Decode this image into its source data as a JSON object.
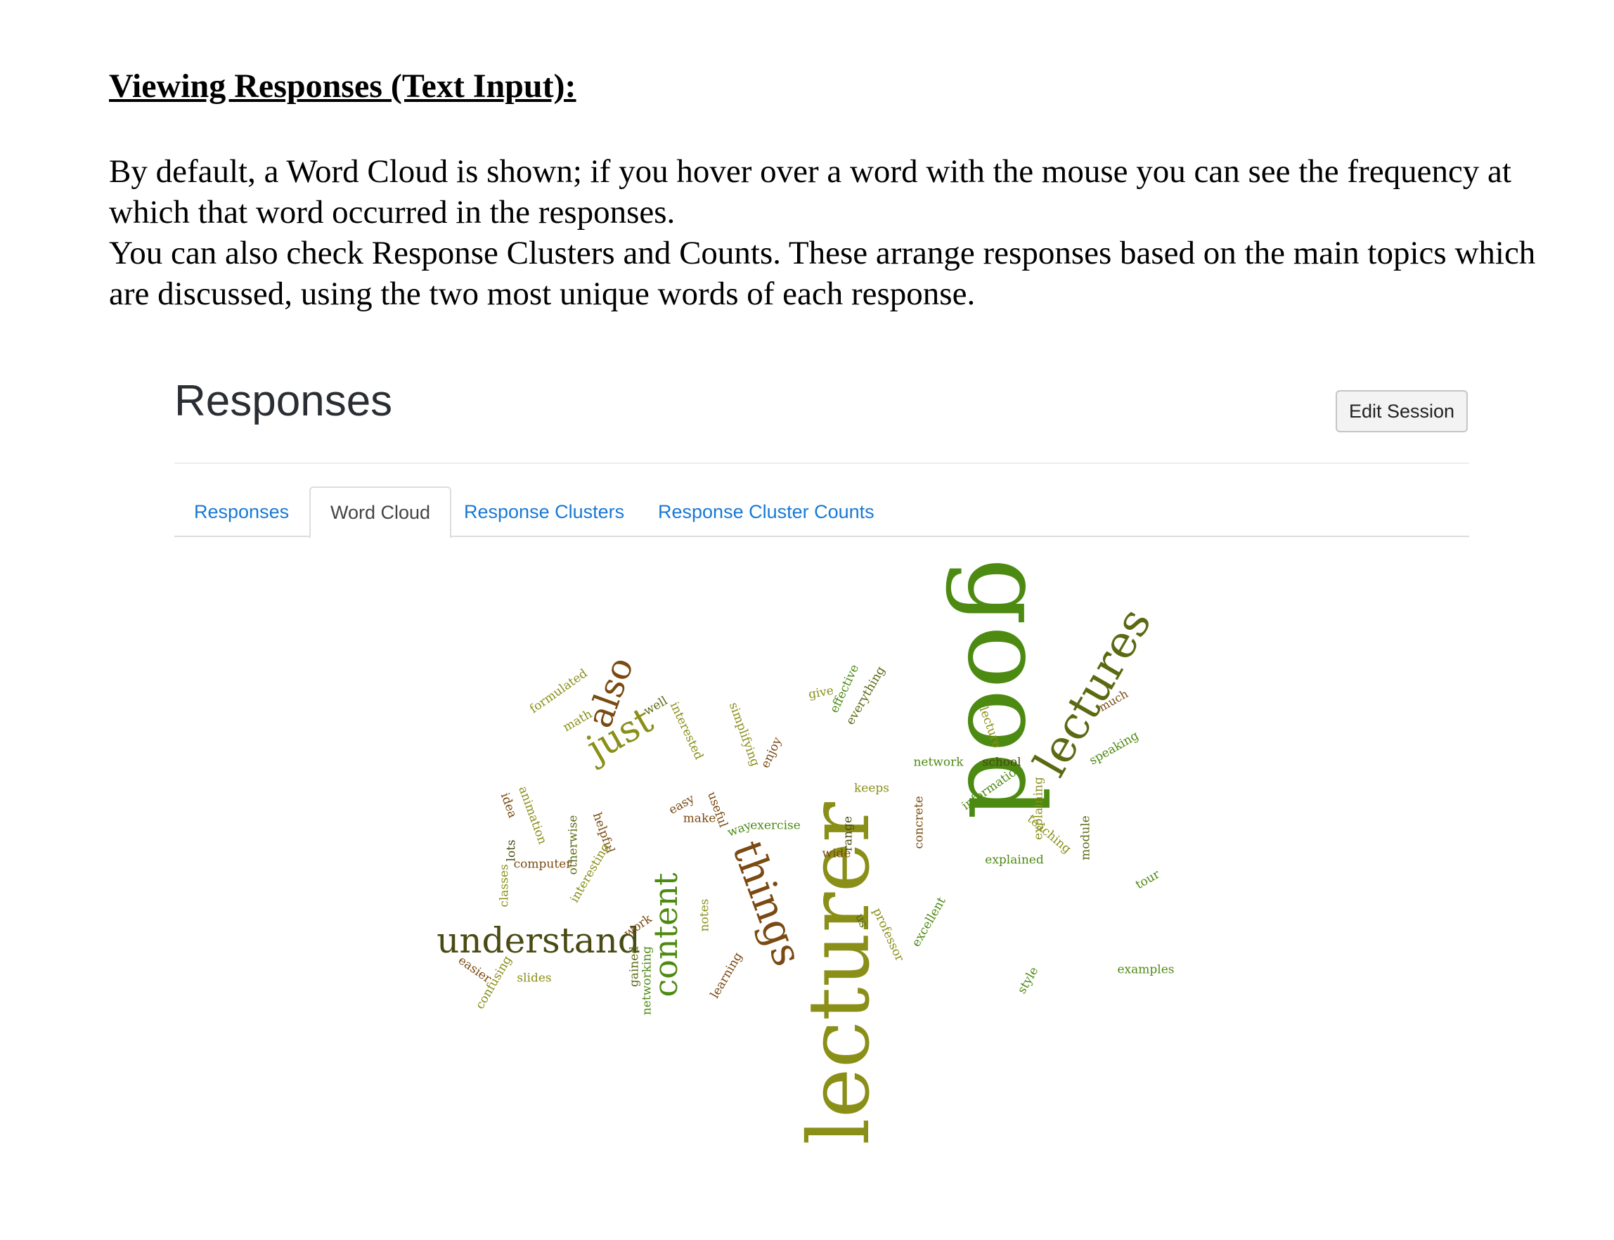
{
  "document": {
    "title": "Viewing Responses (Text Input):",
    "paragraph1": "By default, a Word Cloud is shown; if you hover over a word with the mouse you can see the frequency at which that word occurred in the responses.",
    "paragraph2": "You can also check Response Clusters and Counts. These arrange responses based on the main topics which are discussed, using the two most unique words of each response."
  },
  "ui": {
    "heading": "Responses",
    "edit_button": "Edit Session",
    "tabs": [
      {
        "label": "Responses",
        "active": false
      },
      {
        "label": "Word Cloud",
        "active": true
      },
      {
        "label": "Response Clusters",
        "active": false
      },
      {
        "label": "Response Cluster Counts",
        "active": false
      }
    ],
    "colors": {
      "green": "#4d8a12",
      "olive": "#8a8f18",
      "brown": "#7a4a12",
      "dark": "#4a4a14",
      "link": "#1779d6"
    }
  },
  "word_cloud": [
    {
      "text": "good",
      "color": "#4d8a12"
    },
    {
      "text": "lecturer",
      "color": "#8a8f18"
    },
    {
      "text": "lectures",
      "color": "#5b6a12"
    },
    {
      "text": "things",
      "color": "#7a4a12"
    },
    {
      "text": "understand",
      "color": "#4a4a14"
    },
    {
      "text": "content",
      "color": "#4d8a12"
    },
    {
      "text": "just",
      "color": "#8a8f18"
    },
    {
      "text": "also",
      "color": "#7a4a12"
    },
    {
      "text": "formulated",
      "color": "#8a8f18"
    },
    {
      "text": "math",
      "color": "#8a8f18"
    },
    {
      "text": "well",
      "color": "#5b6a12"
    },
    {
      "text": "interested",
      "color": "#8a8f18"
    },
    {
      "text": "simplifying",
      "color": "#8a8f18"
    },
    {
      "text": "enjoy",
      "color": "#7a4a12"
    },
    {
      "text": "give",
      "color": "#8a8f18"
    },
    {
      "text": "effective",
      "color": "#4d8a12"
    },
    {
      "text": "everything",
      "color": "#5b6a12"
    },
    {
      "text": "much",
      "color": "#7a4a12"
    },
    {
      "text": "speaking",
      "color": "#4d8a12"
    },
    {
      "text": "lecture",
      "color": "#8a8f18"
    },
    {
      "text": "network",
      "color": "#4d8a12"
    },
    {
      "text": "school",
      "color": "#4a4a14"
    },
    {
      "text": "information",
      "color": "#4d8a12"
    },
    {
      "text": "keeps",
      "color": "#8a8f18"
    },
    {
      "text": "explaining",
      "color": "#8a8f18"
    },
    {
      "text": "teaching",
      "color": "#8a8f18"
    },
    {
      "text": "module",
      "color": "#5b6a12"
    },
    {
      "text": "explained",
      "color": "#4d8a12"
    },
    {
      "text": "tour",
      "color": "#4d8a12"
    },
    {
      "text": "examples",
      "color": "#4d8a12"
    },
    {
      "text": "style",
      "color": "#4d8a12"
    },
    {
      "text": "excellent",
      "color": "#4d8a12"
    },
    {
      "text": "professor",
      "color": "#8a8f18"
    },
    {
      "text": "us",
      "color": "#5b6a12"
    },
    {
      "text": "concrete",
      "color": "#7a4a12"
    },
    {
      "text": "range",
      "color": "#4a4a14"
    },
    {
      "text": "wide",
      "color": "#7a4a12"
    },
    {
      "text": "exercise",
      "color": "#4d8a12"
    },
    {
      "text": "way",
      "color": "#4d8a12"
    },
    {
      "text": "make",
      "color": "#7a4a12"
    },
    {
      "text": "easy",
      "color": "#7a4a12"
    },
    {
      "text": "useful",
      "color": "#7a4a12"
    },
    {
      "text": "idea",
      "color": "#7a4a12"
    },
    {
      "text": "animation",
      "color": "#8a8f18"
    },
    {
      "text": "lots",
      "color": "#4a4a14"
    },
    {
      "text": "otherwise",
      "color": "#5b6a12"
    },
    {
      "text": "helpful",
      "color": "#7a4a12"
    },
    {
      "text": "computer",
      "color": "#7a4a12"
    },
    {
      "text": "interesting",
      "color": "#8a8f18"
    },
    {
      "text": "classes",
      "color": "#8a8f18"
    },
    {
      "text": "work",
      "color": "#7a4a12"
    },
    {
      "text": "notes",
      "color": "#8a8f18"
    },
    {
      "text": "gained",
      "color": "#5b6a12"
    },
    {
      "text": "networking",
      "color": "#4d8a12"
    },
    {
      "text": "learning",
      "color": "#7a4a12"
    },
    {
      "text": "slides",
      "color": "#8a8f18"
    },
    {
      "text": "easier",
      "color": "#7a4a12"
    },
    {
      "text": "confusing",
      "color": "#8a8f18"
    }
  ]
}
